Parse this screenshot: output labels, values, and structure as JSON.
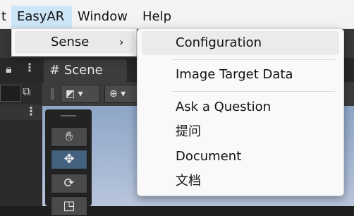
{
  "menubar": {
    "items": [
      "t",
      "EasyAR",
      "Window",
      "Help"
    ]
  },
  "easyar_menu": {
    "items": [
      {
        "label": "Sense",
        "arrow": "›"
      }
    ]
  },
  "sense_menu": {
    "items": [
      {
        "label": "Configuration"
      },
      {
        "label": "Image Target Data"
      },
      {
        "label": "Ask a Question"
      },
      {
        "label": "提问"
      },
      {
        "label": "Document"
      },
      {
        "label": "文档"
      }
    ]
  },
  "editor": {
    "scene_tab": {
      "label": "Scene",
      "icon": "hash-icon"
    },
    "tools": [
      "hand-tool-icon",
      "move-tool-icon",
      "rotate-tool-icon",
      "scale-tool-icon"
    ]
  },
  "colors": {
    "menubar_bg": "#f3f3f3",
    "active_menu_bg": "#cde6f7",
    "menu_bg": "#f9f9f9",
    "editor_bg": "#383838",
    "viewport_sky": "#a6b8d4",
    "selected_tool": "#44617f"
  }
}
